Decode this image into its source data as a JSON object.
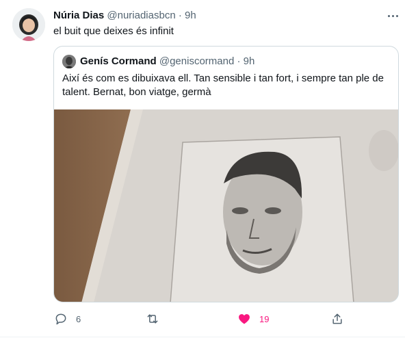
{
  "tweet": {
    "author_name": "Núria Dias",
    "author_handle": "@nuriadiasbcn",
    "separator": "·",
    "time": "9h",
    "text": "el buit que deixes és infinit"
  },
  "quoted": {
    "author_name": "Genís Cormand",
    "author_handle": "@geniscormand",
    "separator": "·",
    "time": "9h",
    "text": "Així és com es dibuixava ell. Tan sensible i tan fort, i sempre tan ple de talent. Bernat, bon viatge, germà"
  },
  "actions": {
    "reply_count": "6",
    "retweet_count": "",
    "like_count": "19",
    "like_color": "#f91880",
    "icons": [
      "reply-icon",
      "retweet-icon",
      "like-icon",
      "share-icon"
    ]
  },
  "colors": {
    "text_primary": "#0f1419",
    "text_secondary": "#536471",
    "border": "#cfd9de"
  }
}
